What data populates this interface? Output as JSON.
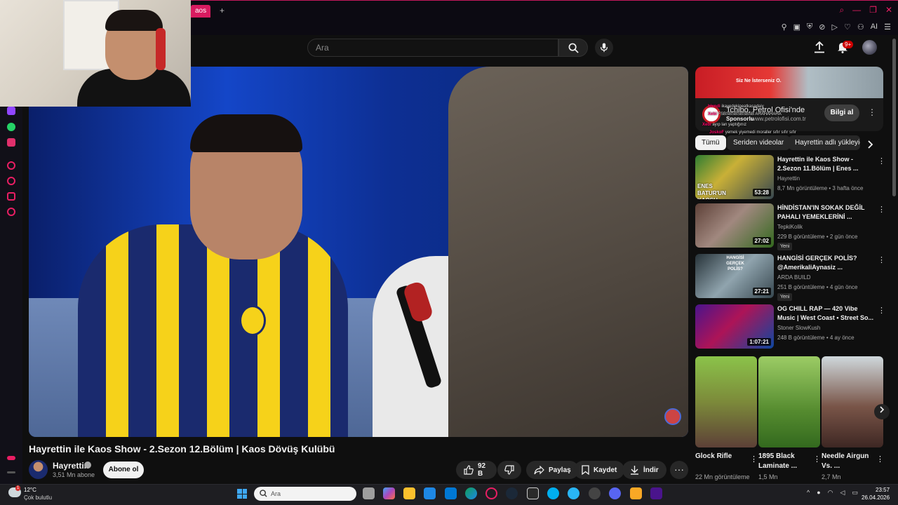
{
  "browser": {
    "tab_label": "aos",
    "new_tab": "+"
  },
  "youtube": {
    "search_placeholder": "Ara",
    "notifications_badge": "9+",
    "video": {
      "title": "Hayrettin ile Kaos Show - 2.Sezon 12.Bölüm | Kaos Dövüş Kulübü",
      "channel": "Hayrettin",
      "subscribers": "3,51 Mn abone",
      "subscribe_label": "Abone ol",
      "likes": "92 B",
      "share_label": "Paylaş",
      "save_label": "Kaydet",
      "download_label": "İndir",
      "more_label": "···"
    },
    "ad": {
      "banner_text": "Siz Ne İsterseniz O.",
      "title": "Tchibo, Petrol Ofisi'nde",
      "sponsor_label": "Sponsorlu",
      "url": "www.petrolofisi.com.tr",
      "cta": "Bilgi al"
    },
    "chat": [
      {
        "user": "hlendi",
        "msg": "ikayedekipeatkasadaiy"
      },
      {
        "user": "Xebi",
        "msg": "FSBSBSBSBSBSB AHAHAHAHA"
      },
      {
        "user": "Xebi",
        "msg": "ayıp lan yaptığınız"
      },
      {
        "user": "JoskoF",
        "msg": "yemek yiyemedi moraller sıfır sıfır sıfır"
      }
    ],
    "chips": [
      "Tümü",
      "Seriden videolar",
      "Hayrettin adlı yükleyic"
    ],
    "recommended": [
      {
        "title": "Hayrettin ile Kaos Show - 2.Sezon 11.Bölüm | Enes ...",
        "channel": "Hayrettin",
        "meta": "8,7 Mn görüntüleme • 3 hafta önce",
        "duration": "53:28",
        "badge": "",
        "thumb_caption": "ENES BATUR'UN KAOSU"
      },
      {
        "title": "HİNDİSTAN'IN SOKAK DEĞİL PAHALI YEMEKLERİNİ ...",
        "channel": "TepkiKolik",
        "meta": "229 B görüntüleme • 2 gün önce",
        "duration": "27:02",
        "badge": "Yeni",
        "thumb_caption": ""
      },
      {
        "title": "HANGİSİ GERÇEK POLİS? @AmerikaliAynasiz ...",
        "channel": "ARDA BUILD",
        "meta": "251 B görüntüleme • 4 gün önce",
        "duration": "27:21",
        "badge": "Yeni",
        "thumb_caption": "HANGİSİ GERÇEK POLİS?"
      },
      {
        "title": "OG CHILL RAP — 420 Vibe Music | West Coast • Street So...",
        "channel": "Stoner SlowKush",
        "meta": "248 B görüntüleme • 4 ay önce",
        "duration": "1:07:21",
        "badge": "",
        "thumb_caption": ""
      }
    ],
    "shorts": [
      {
        "title": "Glock Rifle",
        "views": "22 Mn görüntüleme"
      },
      {
        "title": "1895 Black Laminate ...",
        "views": "1,5 Mn"
      },
      {
        "title": "Needle Airgun Vs. ...",
        "views": "2,7 Mn"
      }
    ]
  },
  "taskbar": {
    "weather_badge": "1",
    "temperature": "12°C",
    "weather": "Çok bulutlu",
    "search_placeholder": "Ara",
    "time": "23:57",
    "date": "26.04.2026"
  },
  "colors": {
    "accent": "#e91e63",
    "youtube_red": "#cc0000",
    "background": "#0f0f0f"
  }
}
